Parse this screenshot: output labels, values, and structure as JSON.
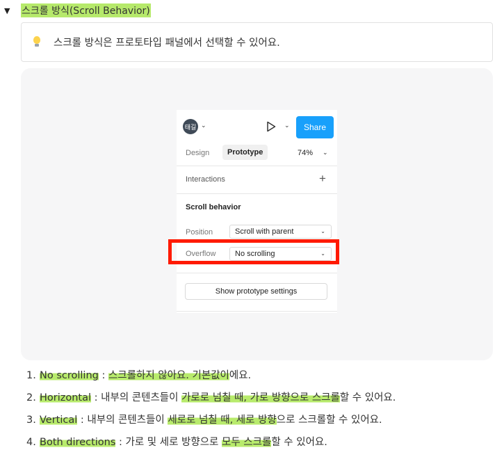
{
  "toggle": {
    "arrow": "▼",
    "title": "스크롤 방식(Scroll Behavior)"
  },
  "callout": {
    "icon": "lightbulb-icon",
    "text": "스크롤 방식은 프로토타입 패널에서 선택할 수 있어요."
  },
  "panel": {
    "avatar": "태길",
    "share": "Share",
    "tabs": {
      "design": "Design",
      "prototype": "Prototype"
    },
    "zoom": "74%",
    "interactions": "Interactions",
    "scroll_behavior": "Scroll behavior",
    "position_label": "Position",
    "position_value": "Scroll with parent",
    "overflow_label": "Overflow",
    "overflow_value": "No scrolling",
    "settings_button": "Show prototype settings"
  },
  "list": [
    {
      "num": "1.",
      "term": "No scrolling",
      "sep": " : ",
      "hl": "스크롤하지 않아요. 기본값이",
      "rest": "에요."
    },
    {
      "num": "2.",
      "term": "Horizontal",
      "sep": " : 내부의 콘텐츠들이 ",
      "hl": "가로로 넘칠 때, 가로 방향으로 스크롤",
      "rest": "할 수 있어요."
    },
    {
      "num": "3.",
      "term": "Vertical",
      "sep": " : 내부의 콘텐츠들이 ",
      "hl": "세로로 넘칠 때, 세로 방향",
      "rest": "으로 스크롤할 수 있어요."
    },
    {
      "num": "4.",
      "term": "Both directions",
      "sep": " : 가로 및 세로 방향으로 ",
      "hl": "모두 스크롤",
      "rest": "할 수 있어요."
    }
  ],
  "colors": {
    "highlight": "#b6e96b",
    "share": "#18a0fb",
    "callout_border": "#ff1a00"
  }
}
